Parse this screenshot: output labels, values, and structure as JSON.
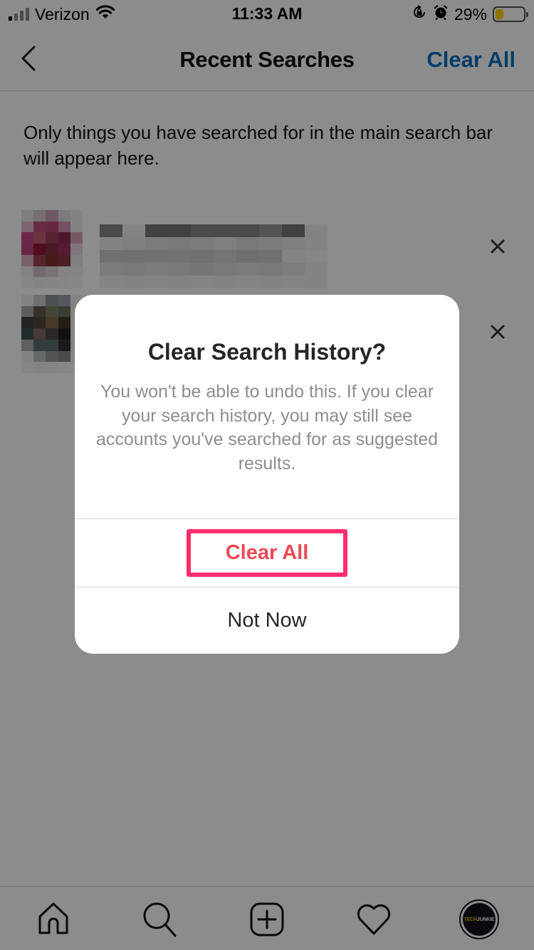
{
  "status_bar": {
    "carrier": "Verizon",
    "time": "11:33 AM",
    "battery_percent_label": "29%",
    "battery_level": 0.29,
    "signal_bars_active": 1,
    "signal_bars_total": 4,
    "icons": [
      "signal-icon",
      "wifi-icon",
      "orientation-lock-icon",
      "alarm-icon",
      "battery-icon"
    ],
    "battery_color": "#ffd60a"
  },
  "nav": {
    "back_icon": "chevron-left-icon",
    "title": "Recent Searches",
    "action_label": "Clear All",
    "action_color": "#0095f6"
  },
  "info_text": "Only things you have searched for in the main search bar will appear here.",
  "recent_items": [
    {
      "name": "[pixelated account]",
      "remove_icon": "close-icon"
    },
    {
      "name": "[pixelated account]",
      "remove_icon": "close-icon"
    }
  ],
  "dialog": {
    "title": "Clear Search History?",
    "body": "You won't be able to undo this. If you clear your search history, you may still see accounts you've searched for as suggested results.",
    "confirm_label": "Clear All",
    "cancel_label": "Not Now",
    "confirm_color": "#ed4956",
    "highlight_color": "#ff2e6e"
  },
  "tab_bar": {
    "tabs": [
      {
        "name": "home",
        "icon": "home-icon"
      },
      {
        "name": "search",
        "icon": "search-icon"
      },
      {
        "name": "new-post",
        "icon": "plus-square-icon"
      },
      {
        "name": "activity",
        "icon": "heart-icon"
      },
      {
        "name": "profile",
        "icon": "profile-avatar"
      }
    ],
    "profile_logo_part1": "TECH",
    "profile_logo_part2": "JUNKIE"
  }
}
